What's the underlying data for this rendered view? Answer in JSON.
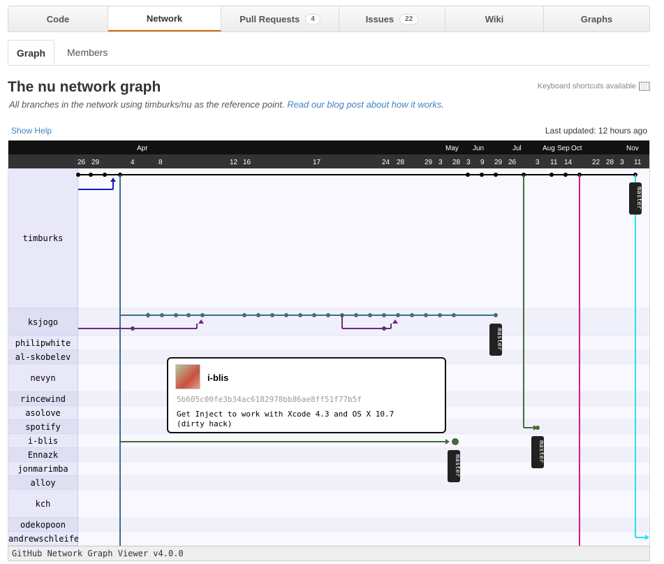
{
  "repo_tabs": [
    {
      "label": "Code",
      "badge": ""
    },
    {
      "label": "Network",
      "badge": ""
    },
    {
      "label": "Pull Requests",
      "badge": "4"
    },
    {
      "label": "Issues",
      "badge": "22"
    },
    {
      "label": "Wiki",
      "badge": ""
    },
    {
      "label": "Graphs",
      "badge": ""
    }
  ],
  "subtabs": [
    "Graph",
    "Members"
  ],
  "page": {
    "title": "The nu network graph",
    "subtitle_prefix": "All branches in the network using ",
    "subtitle_repo": "timburks/nu",
    "subtitle_mid": " as the reference point. ",
    "subtitle_link": "Read our blog post about how it works",
    "subtitle_suffix": ".",
    "keyboard": "Keyboard shortcuts available",
    "show_help": "Show Help",
    "last_updated": "Last updated: 12 hours ago"
  },
  "graph": {
    "months": [
      "Apr",
      "May",
      "Jun",
      "Jul",
      "Aug",
      "Sep",
      "Oct",
      "Nov"
    ],
    "days": [
      "26",
      "29",
      "4",
      "8",
      "12",
      "16",
      "17",
      "24",
      "28",
      "29",
      "3",
      "28",
      "3",
      "9",
      "29",
      "26",
      "3",
      "11",
      "14",
      "22",
      "28",
      "3",
      "11"
    ],
    "users": [
      "timburks",
      "ksjogo",
      "philipwhite",
      "al-skobelev",
      "nevyn",
      "rincewind",
      "asolove",
      "spotify",
      "i-blis",
      "Ennazk",
      "jonmarimba",
      "alloy",
      "kch",
      "odekopoon",
      "andrewschleifer"
    ],
    "branch_label": "master",
    "colors": {
      "timburks": "#000000",
      "ksjogo": "#3c6e85",
      "ksjogo_fork": "#6b2a7a",
      "ksjogo_in": "#1a1abf",
      "spotify": "#456a3a",
      "iblis": "#456a3a",
      "pink": "#d6197a",
      "cyan": "#21e4ee"
    }
  },
  "popup": {
    "user": "i-blis",
    "sha": "5b605c00fe3b34ac6182978bb86ae8ff51f77b5f",
    "message": "Get Inject to work with Xcode 4.3 and OS X 10.7\n(dirty hack)"
  },
  "footer": "GitHub Network Graph Viewer v4.0.0"
}
